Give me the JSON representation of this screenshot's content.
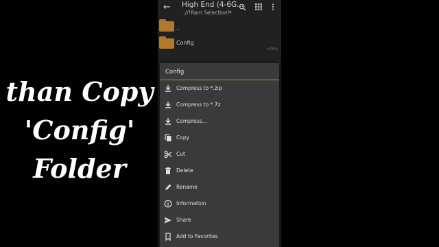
{
  "overlay": {
    "lines": [
      "than Copy",
      "'Config'",
      "Folder"
    ]
  },
  "appbar": {
    "title": "High End (4-6G...",
    "path": "..//!Ram Selection!",
    "icons": [
      "back-arrow-icon",
      "search-icon",
      "grid-view-icon",
      "more-vert-icon"
    ]
  },
  "files": [
    {
      "name": "..",
      "meta": ""
    },
    {
      "name": "Config",
      "meta": "<DIR>"
    }
  ],
  "menu": {
    "title": "Config",
    "accent": "#9aa53a",
    "items": [
      {
        "label": "Compress to *.zip",
        "icon": "download-icon"
      },
      {
        "label": "Compress to *.7z",
        "icon": "download-icon"
      },
      {
        "label": "Compress...",
        "icon": "download-icon"
      },
      {
        "label": "Copy",
        "icon": "copy-icon"
      },
      {
        "label": "Cut",
        "icon": "scissors-icon"
      },
      {
        "label": "Delete",
        "icon": "trash-icon"
      },
      {
        "label": "Rename",
        "icon": "pencil-icon"
      },
      {
        "label": "Information",
        "icon": "info-icon"
      },
      {
        "label": "Share",
        "icon": "share-icon"
      },
      {
        "label": "Add to Favorites",
        "icon": "bookmark-icon"
      }
    ]
  }
}
